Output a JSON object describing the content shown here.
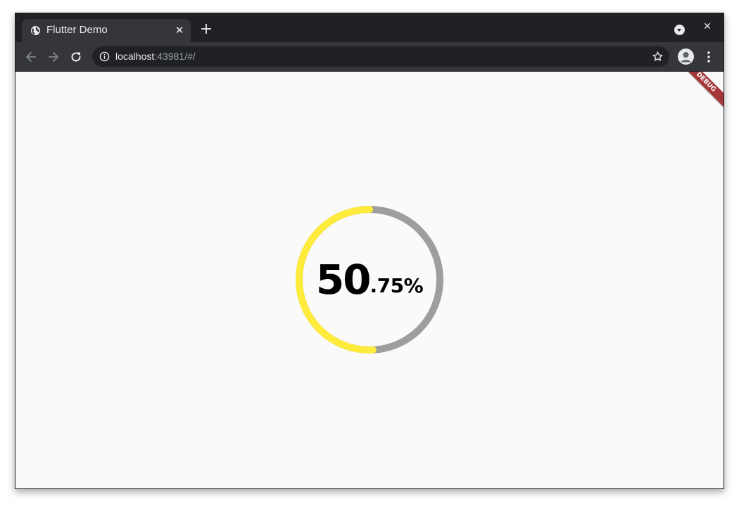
{
  "browser": {
    "tab": {
      "title": "Flutter Demo",
      "favicon": "globe-icon",
      "close_glyph": "✕"
    },
    "new_tab_glyph": "+",
    "window_close_glyph": "✕",
    "address": {
      "host": "localhost",
      "rest": ":43981/#/"
    }
  },
  "app": {
    "progress": {
      "integer": "50",
      "fraction": ".75%",
      "value_percent": 50.75,
      "progress_color": "#ffeb3b",
      "track_color": "#9e9e9e"
    },
    "debug_banner": "DEBUG"
  }
}
